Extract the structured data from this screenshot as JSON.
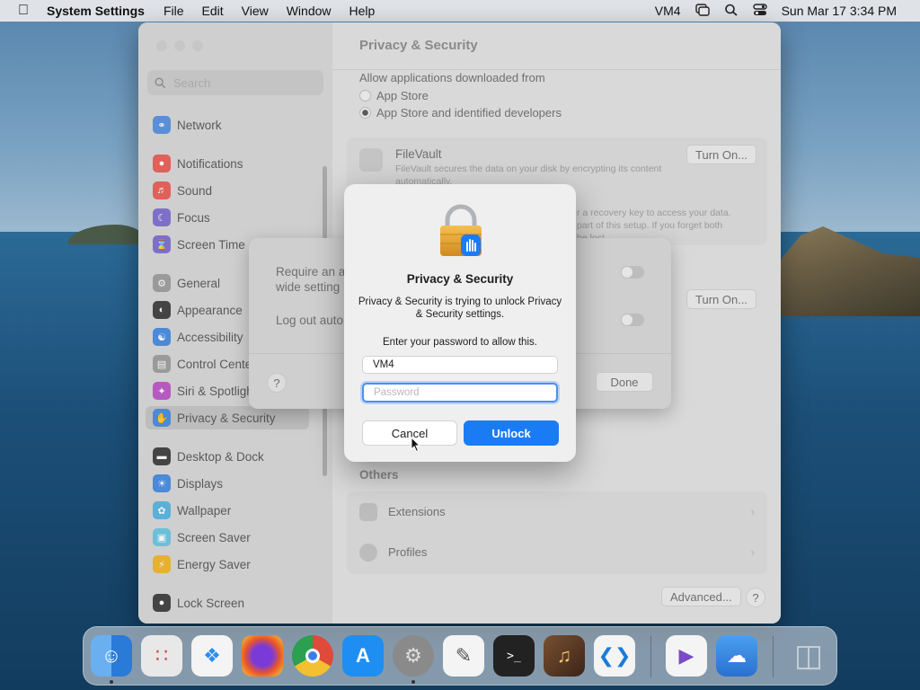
{
  "menubar": {
    "app_name": "System Settings",
    "menus": [
      "File",
      "Edit",
      "View",
      "Window",
      "Help"
    ],
    "user": "VM4",
    "datetime": "Sun Mar 17  3:34 PM"
  },
  "sidebar": {
    "search_placeholder": "Search",
    "items": [
      {
        "label": "Network",
        "icon": "globe-icon",
        "color": "#5a8fd6"
      },
      {
        "label": "Notifications",
        "icon": "bell-icon",
        "color": "#e0605a"
      },
      {
        "label": "Sound",
        "icon": "speaker-icon",
        "color": "#e0605a"
      },
      {
        "label": "Focus",
        "icon": "moon-icon",
        "color": "#7e6fc9"
      },
      {
        "label": "Screen Time",
        "icon": "hourglass-icon",
        "color": "#7e6fc9"
      },
      {
        "label": "General",
        "icon": "gear-icon",
        "color": "#9a9a9a"
      },
      {
        "label": "Appearance",
        "icon": "appearance-icon",
        "color": "#444444"
      },
      {
        "label": "Accessibility",
        "icon": "accessibility-icon",
        "color": "#4a8ad8"
      },
      {
        "label": "Control Center",
        "icon": "control-center-icon",
        "color": "#9a9a9a"
      },
      {
        "label": "Siri & Spotlight",
        "icon": "siri-icon",
        "color": "#b55ac0"
      },
      {
        "label": "Privacy & Security",
        "icon": "hand-icon",
        "color": "#4a8ad8"
      },
      {
        "label": "Desktop & Dock",
        "icon": "dock-icon",
        "color": "#444444"
      },
      {
        "label": "Displays",
        "icon": "sun-icon",
        "color": "#4a8ad8"
      },
      {
        "label": "Wallpaper",
        "icon": "wallpaper-icon",
        "color": "#5ab0d8"
      },
      {
        "label": "Screen Saver",
        "icon": "screensaver-icon",
        "color": "#6ac0d8"
      },
      {
        "label": "Energy Saver",
        "icon": "battery-icon",
        "color": "#e8b030"
      },
      {
        "label": "Lock Screen",
        "icon": "lock-icon",
        "color": "#444444"
      }
    ]
  },
  "main": {
    "title": "Privacy & Security",
    "allow_label": "Allow applications downloaded from",
    "option_app_store": "App Store",
    "option_identified": "App Store and identified developers",
    "filevault_title": "FileVault",
    "filevault_desc": "FileVault secures the data on your disk by encrypting its content automatically.",
    "filevault_extra_1": "r a recovery key to access your data.",
    "filevault_extra_2": "part of this setup. If you forget both",
    "filevault_extra_3": "be lost.",
    "turn_on_label": "Turn On...",
    "others_header": "Others",
    "extensions_label": "Extensions",
    "profiles_label": "Profiles",
    "advanced_label": "Advanced...",
    "help_label": "?"
  },
  "sheet": {
    "require_label_1": "Require an a",
    "require_label_2": "wide setting",
    "logout_label": "Log out auto",
    "help_label": "?",
    "done_label": "Done"
  },
  "dialog": {
    "title": "Privacy & Security",
    "message": "Privacy & Security is trying to unlock Privacy & Security settings.",
    "prompt": "Enter your password to allow this.",
    "username_value": "VM4",
    "password_placeholder": "Password",
    "cancel_label": "Cancel",
    "unlock_label": "Unlock"
  },
  "dock": {
    "apps": [
      {
        "name": "finder-icon",
        "color": "#3a8ee6"
      },
      {
        "name": "launchpad-icon",
        "color": "#e8e8e8"
      },
      {
        "name": "safari-icon",
        "color": "#2a8ef0"
      },
      {
        "name": "firefox-icon",
        "color": "#e8562a"
      },
      {
        "name": "chrome-icon",
        "color": "#f2f2f2"
      },
      {
        "name": "app-store-icon",
        "color": "#1f8ef2"
      },
      {
        "name": "system-settings-icon",
        "color": "#8a8a8a"
      },
      {
        "name": "textedit-icon",
        "color": "#f4f4f4"
      },
      {
        "name": "terminal-icon",
        "color": "#222222"
      },
      {
        "name": "garageband-icon",
        "color": "#5a3a2a"
      },
      {
        "name": "vscode-icon",
        "color": "#f4f4f4"
      },
      {
        "name": "visual-studio-icon",
        "color": "#f4f4f4"
      },
      {
        "name": "weather-icon",
        "color": "#3a8ee6"
      },
      {
        "name": "trash-icon",
        "color": "#d8dde2"
      }
    ]
  }
}
